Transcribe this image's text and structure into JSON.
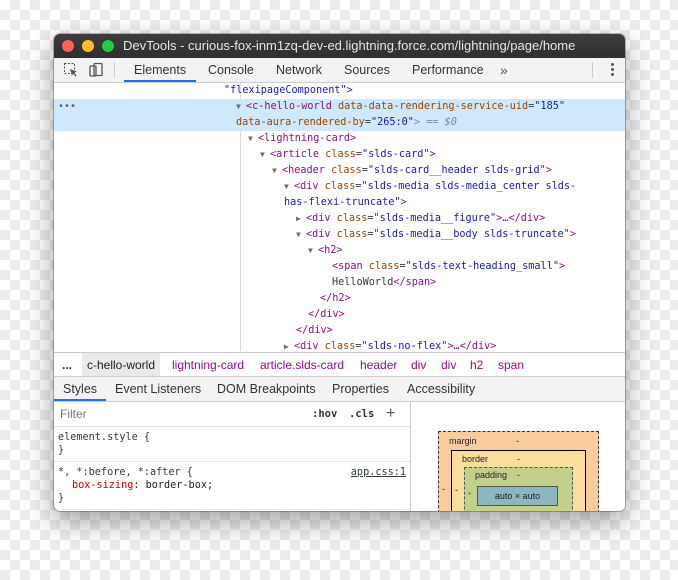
{
  "window": {
    "title": "DevTools - curious-fox-inm1zq-dev-ed.lightning.force.com/lightning/page/home"
  },
  "toolbar": {
    "tabs": [
      "Elements",
      "Console",
      "Network",
      "Sources",
      "Performance"
    ],
    "active_tab": "Elements",
    "more": "»"
  },
  "dom": {
    "l0": "\"flexipageComponent\">",
    "l1_tag": "<c-hello-world",
    "l1_attr1": " data-data-rendering-service-uid",
    "l1_val1": "\"185\"",
    "l1b_attr2": "data-aura-rendered-by",
    "l1b_val2": "\"265:0\"",
    "l1b_tail": "> == $0",
    "l2": "<lightning-card>",
    "l3_tag": "<article",
    "l3_attr": " class",
    "l3_val": "\"slds-card\"",
    "l4_tag": "<header",
    "l4_attr": " class",
    "l4_val": "\"slds-card__header slds-grid\"",
    "l5_tag": "<div",
    "l5_attr": " class",
    "l5_val": "\"slds-media slds-media_center slds-",
    "l5b_val": "has-flexi-truncate\"",
    "l6_tag": "<div",
    "l6_attr": " class",
    "l6_val": "\"slds-media__figure\"",
    "l6_tail": ">…</div>",
    "l7_tag": "<div",
    "l7_attr": " class",
    "l7_val": "\"slds-media__body slds-truncate\"",
    "l8": "<h2>",
    "l9_tag": "<span",
    "l9_attr": " class",
    "l9_val": "\"slds-text-heading_small\"",
    "l10_text": "HelloWorld",
    "l10_tag": "</span>",
    "l11": "</h2>",
    "l12": "</div>",
    "l13": "</div>",
    "l14_tag": "<div",
    "l14_attr": " class",
    "l14_val": "\"slds-no-flex\"",
    "l14_tail": ">…</div>"
  },
  "breadcrumbs": [
    "...",
    "c-hello-world",
    "lightning-card",
    "article.slds-card",
    "header",
    "div",
    "div",
    "h2",
    "span"
  ],
  "subtabs": [
    "Styles",
    "Event Listeners",
    "DOM Breakpoints",
    "Properties",
    "Accessibility"
  ],
  "styles": {
    "filter_placeholder": "Filter",
    "hov": ":hov",
    "cls": ".cls",
    "plus": "+",
    "rule1_selector": "element.style {",
    "rule1_close": "}",
    "rule2_selector": "*, *:before, *:after {",
    "rule2_source": "app.css:1",
    "rule2_prop": "box-sizing",
    "rule2_value": "border-box;",
    "rule2_close": "}"
  },
  "box_model": {
    "margin_label": "margin",
    "border_label": "border",
    "padding_label": "padding",
    "dash": "-",
    "content": "auto × auto"
  }
}
